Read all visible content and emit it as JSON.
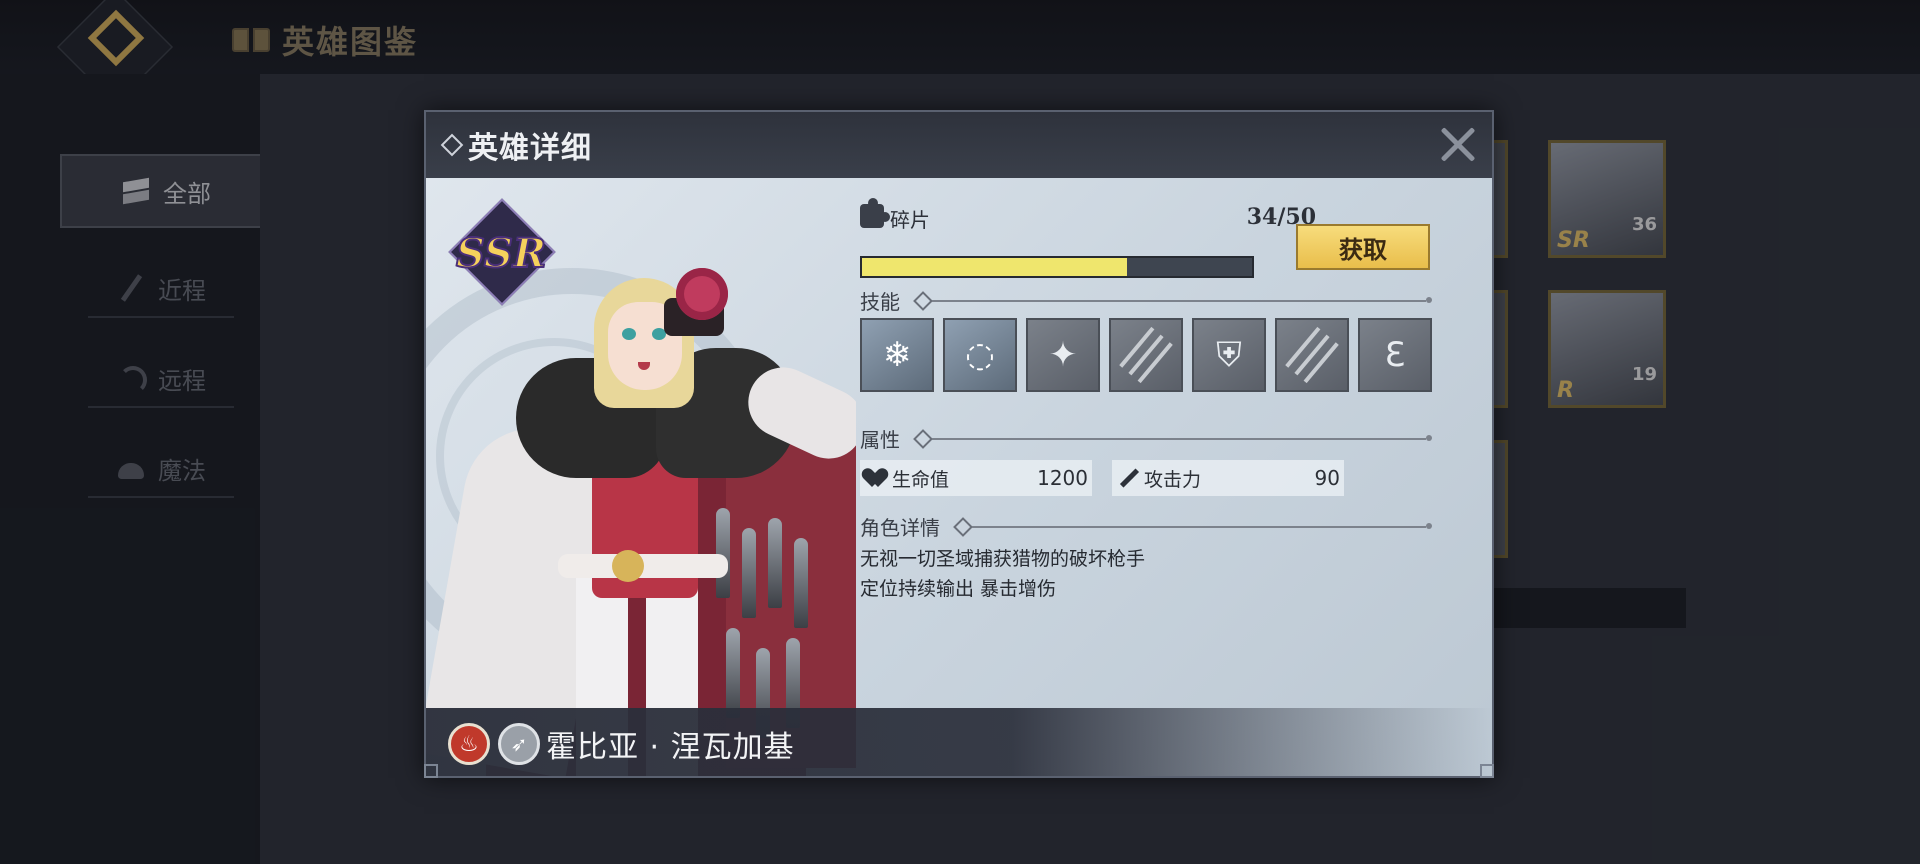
{
  "page": {
    "title": "英雄图鉴"
  },
  "sidebar": {
    "items": [
      {
        "label": "全部",
        "icon": "stack-icon",
        "active": true
      },
      {
        "label": "近程",
        "icon": "sword-icon",
        "active": false
      },
      {
        "label": "远程",
        "icon": "bow-icon",
        "active": false
      },
      {
        "label": "魔法",
        "icon": "wizard-hat-icon",
        "active": false
      }
    ]
  },
  "background_cards": [
    {
      "level": "36",
      "rarity": "SR"
    },
    {
      "level": "19",
      "rarity": "R"
    }
  ],
  "dialog": {
    "title": "英雄详细",
    "hero": {
      "rarity": "SSR",
      "name": "霍比亚 · 涅瓦加基",
      "element_icon": "fire-icon",
      "class_icon": "bow-icon"
    },
    "fragments": {
      "label": "碎片",
      "count_text": "34/50",
      "current": 34,
      "max": 50,
      "get_button": "获取"
    },
    "skills": {
      "label": "技能",
      "icons": [
        "ice-shards-icon",
        "vortex-icon",
        "impact-icon",
        "triple-slash-icon",
        "broken-shield-icon",
        "triple-slash-icon",
        "claw-icon"
      ]
    },
    "attributes": {
      "label": "属性",
      "hp_label": "生命值",
      "hp_value": "1200",
      "atk_label": "攻击力",
      "atk_value": "90"
    },
    "details": {
      "label": "角色详情",
      "line1": "无视一切圣域捕获猎物的破坏枪手",
      "line2": "定位持续输出 暴击增伤"
    }
  },
  "colors": {
    "accent_gold": "#e9be4b",
    "progress_fill": "#efe66d",
    "fire_element": "#c0392b"
  }
}
